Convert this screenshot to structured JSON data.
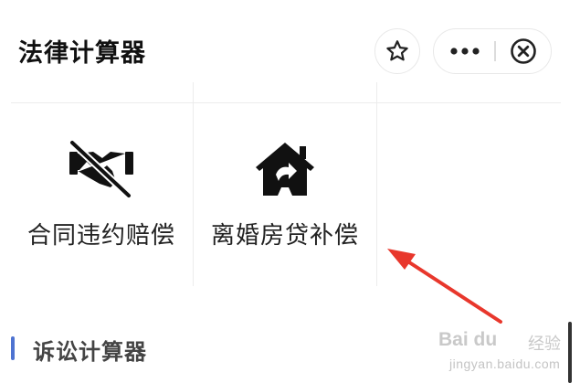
{
  "header": {
    "title": "法律计算器",
    "actions": [
      {
        "icon": "star-icon",
        "purpose": "favorite"
      },
      {
        "icon": "more-icon",
        "purpose": "more"
      },
      {
        "icon": "close-circle-icon",
        "purpose": "close"
      }
    ]
  },
  "tools": [
    {
      "label": "合同违约赔偿",
      "icon": "broken-handshake-icon"
    },
    {
      "label": "离婚房贷补偿",
      "icon": "house-transfer-icon"
    }
  ],
  "section": {
    "title": "诉讼计算器",
    "accent_color": "#4e73d1"
  },
  "annotation": {
    "arrow_color": "#e8372c"
  },
  "watermark": {
    "logo": "Bai du",
    "brand": "经验",
    "url": "jingyan.baidu.com"
  }
}
